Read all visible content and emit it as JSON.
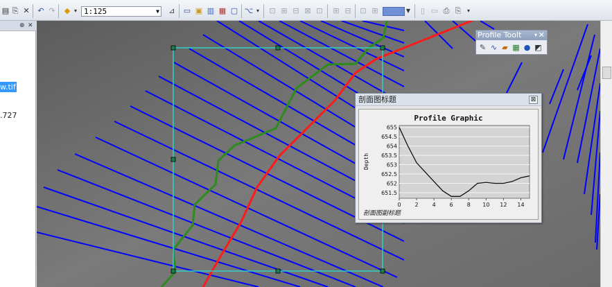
{
  "toolbar": {
    "scale_value": "1:125"
  },
  "toc": {
    "selected_layer_text": "w.tif",
    "value_text": ".727"
  },
  "profile_toolbar": {
    "title": "Profile Toolt"
  },
  "profile_window": {
    "title": "剖面图标题",
    "close_label": "⊠"
  },
  "chart_data": {
    "type": "line",
    "title": "Profile Graphic",
    "xlabel": "",
    "ylabel": "Depth",
    "footnote": "剖面图副标题",
    "x_ticks": [
      0,
      2,
      4,
      6,
      8,
      10,
      12,
      14
    ],
    "y_ticks": [
      651.5,
      652,
      652.5,
      653,
      653.5,
      654,
      654.5,
      655
    ],
    "y_tick_labels": [
      "651.5",
      "652",
      "652.5",
      "653",
      "653.5",
      "654",
      "654.5",
      "655"
    ],
    "xlim": [
      0,
      15
    ],
    "ylim": [
      651.2,
      655.1
    ],
    "grid": "horizontal",
    "x": [
      0,
      1,
      2,
      3,
      4,
      5,
      6,
      7,
      8,
      9,
      10,
      11,
      12,
      13,
      14,
      15
    ],
    "y": [
      655.0,
      654.0,
      653.1,
      652.6,
      652.1,
      651.6,
      651.3,
      651.3,
      651.6,
      652.0,
      652.05,
      652.0,
      652.0,
      652.1,
      652.3,
      652.4
    ]
  },
  "colors": {
    "profile_lines": "#0000ff",
    "center_line": "#ff0000",
    "green_line": "#2e8b1e",
    "selection_box": "#2fd0c8",
    "map_background": "#6f6f6f"
  },
  "icons": [
    "save-icon",
    "copy-icon",
    "delete-icon",
    "undo-icon",
    "redo-icon",
    "add-data-icon",
    "pan-icon",
    "identify-icon",
    "zoom-icon",
    "layout-icon",
    "measure-icon",
    "color-picker-icon",
    "pencil-icon",
    "profile-icon",
    "layers-icon",
    "table-icon",
    "globe-icon",
    "graph-icon",
    "close-icon"
  ]
}
